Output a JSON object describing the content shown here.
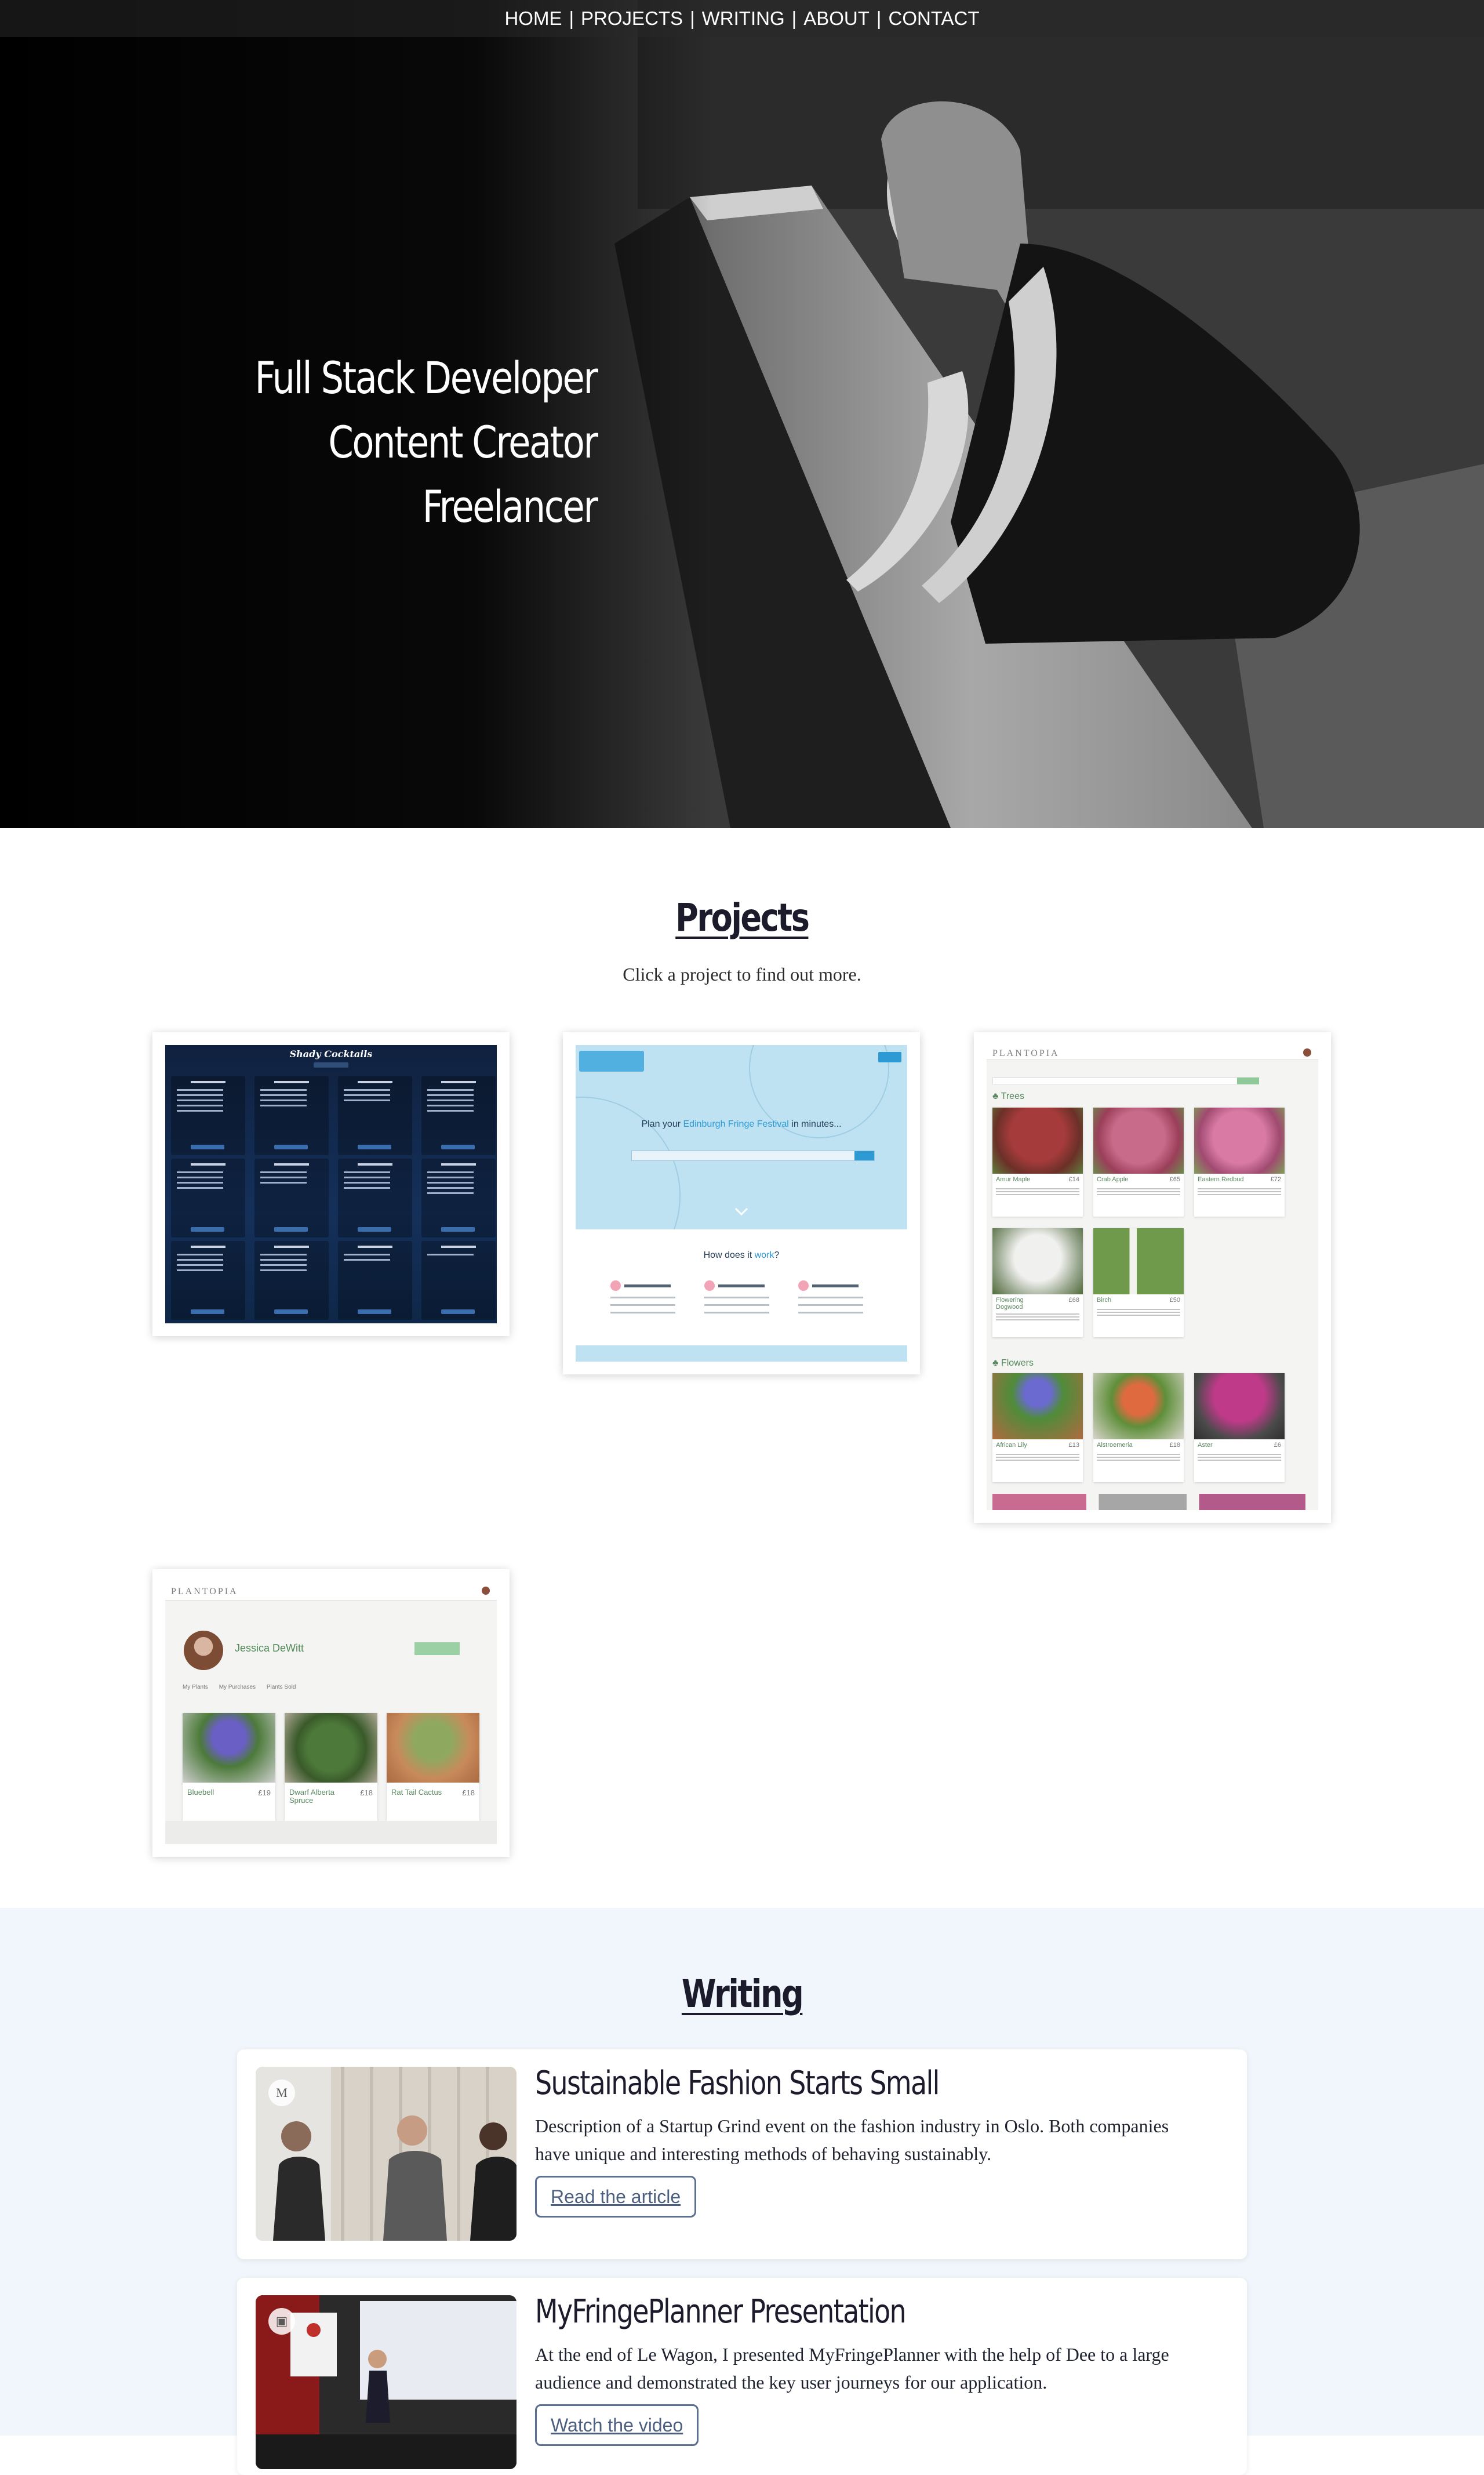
{
  "nav": {
    "items": [
      "HOME",
      "PROJECTS",
      "WRITING",
      "ABOUT",
      "CONTACT"
    ],
    "separator": "|"
  },
  "hero": {
    "lines": [
      "Full Stack Developer",
      "Content Creator",
      "Freelancer"
    ]
  },
  "projects": {
    "title": "Projects",
    "subtitle": "Click a project to find out more.",
    "cards": [
      {
        "name": "Shady Cocktails",
        "button": "Add New Drink",
        "columns": [
          "Spicy Flavors of Cures",
          "Spanish Sunset",
          "Pain Duck Terre",
          "Hojo Tiol",
          "Gross Fer Mang",
          "Tuffy",
          "Wal Yoh Tiyti",
          "Taint Gender",
          "Aspet Viondi Tyrt",
          "Magnifique Lemeade'3",
          "Dudes Navy",
          "Hop Tips"
        ]
      },
      {
        "logo": "myFringePlanner",
        "title_pre": "Plan your",
        "title_link": "Edinburgh Fringe Festival",
        "title_post": "in minutes...",
        "how_pre": "How does it",
        "how_link": "work",
        "how_post": "?",
        "steps": [
          "Search for shows",
          "Create a shortlist",
          "Build a planner"
        ]
      },
      {
        "logo": "PLANTOPIA",
        "search_placeholder": "Find a plant",
        "sections": [
          "Trees",
          "Flowers"
        ],
        "trees": [
          {
            "name": "Amur Maple",
            "price": "£14"
          },
          {
            "name": "Crab Apple",
            "price": "£65"
          },
          {
            "name": "Eastern Redbud",
            "price": "£72"
          },
          {
            "name": "Flowering Dogwood",
            "price": "£68"
          },
          {
            "name": "Birch",
            "price": "£50"
          }
        ],
        "flowers": [
          {
            "name": "African Lily",
            "price": "£13"
          },
          {
            "name": "Alstroemeria",
            "price": "£18"
          },
          {
            "name": "Aster",
            "price": "£6"
          }
        ]
      },
      {
        "logo": "PLANTOPIA",
        "profile_name": "Jessica DeWitt",
        "add_button": "Add New Plant",
        "tabs": [
          "My Plants",
          "My Purchases",
          "Plants Sold"
        ],
        "plants": [
          {
            "name": "Bluebell",
            "price": "£19"
          },
          {
            "name": "Dwarf Alberta Spruce",
            "price": "£18"
          },
          {
            "name": "Rat Tail Cactus",
            "price": "£18"
          }
        ]
      }
    ]
  },
  "writing": {
    "title": "Writing",
    "posts": [
      {
        "badge": "M",
        "title": "Sustainable Fashion Starts Small",
        "description": "Description of a Startup Grind event on the fashion industry in Oslo. Both companies have unique and interesting methods of behaving sustainably.",
        "button": "Read the article"
      },
      {
        "badge": "▣",
        "title": "MyFringePlanner Presentation",
        "description": "At the end of Le Wagon, I presented MyFringePlanner with the help of Dee to a large audience and demonstrated the key user journeys for our application.",
        "button": "Watch the video"
      }
    ]
  },
  "colors": {
    "accent_blue": "#2d9ad4",
    "plant_green": "#55895c",
    "writing_bg": "#f1f6fd",
    "button_border": "#5b6f8f"
  }
}
